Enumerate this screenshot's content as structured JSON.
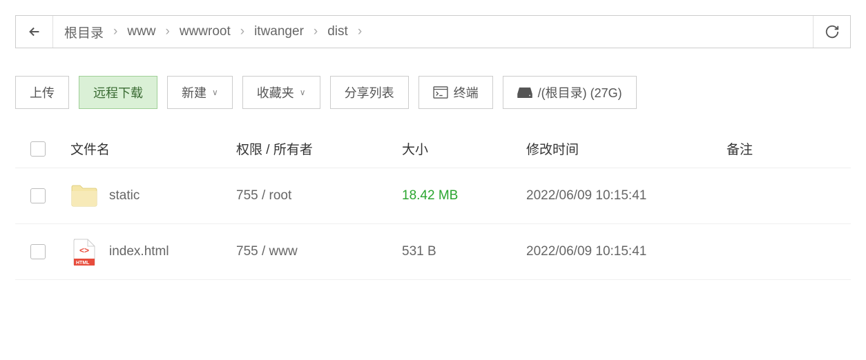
{
  "breadcrumb": {
    "items": [
      "根目录",
      "www",
      "wwwroot",
      "itwanger",
      "dist"
    ]
  },
  "toolbar": {
    "upload": "上传",
    "remote_download": "远程下载",
    "new_dropdown": "新建",
    "favorites": "收藏夹",
    "share_list": "分享列表",
    "terminal": "终端",
    "disk": "/(根目录) (27G)"
  },
  "table": {
    "headers": {
      "fname": "文件名",
      "perm": "权限 / 所有者",
      "size": "大小",
      "mtime": "修改时间",
      "note": "备注"
    },
    "rows": [
      {
        "icon": "folder",
        "name": "static",
        "perm": "755 / root",
        "size": "18.42 MB",
        "size_green": true,
        "mtime": "2022/06/09 10:15:41",
        "note": ""
      },
      {
        "icon": "html",
        "name": "index.html",
        "perm": "755 / www",
        "size": "531 B",
        "size_green": false,
        "mtime": "2022/06/09 10:15:41",
        "note": ""
      }
    ]
  }
}
